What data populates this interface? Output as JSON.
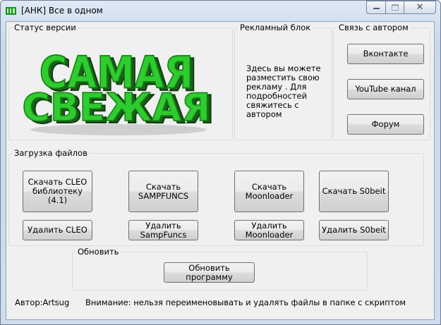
{
  "window": {
    "title": "[АНК] Все в одном",
    "minimize_icon": "minimize-icon",
    "maximize_icon": "maximize-icon",
    "close_icon": "close-icon",
    "close_glyph": "✕"
  },
  "version_group": {
    "label": "Статус версии",
    "logo_line1": "САМАЯ",
    "logo_line2": "СВЕЖАЯ",
    "logo_color": "#2ecc2e"
  },
  "ad_group": {
    "label": "Рекламный блок",
    "text": "Здесь вы можете разместить свою рекламу . Для подробностей свяжитесь с автором"
  },
  "contact_group": {
    "label": "Связь с автором",
    "buttons": [
      "Вконтакте",
      "YouTube канал",
      "Форум"
    ]
  },
  "downloads_group": {
    "label": "Загрузка файлов",
    "download_buttons": [
      "Скачать CLEO библиотеку (4.1)",
      "Скачать SAMPFUNCS",
      "Скачать Moonloader",
      "Скачать S0beit"
    ],
    "delete_buttons": [
      "Удалить CLEO",
      "Удалить SampFuncs",
      "Удалить Moonloader",
      "Удалить S0beit"
    ]
  },
  "update_group": {
    "label": "Обновить",
    "button": "Обновить программу"
  },
  "footer": {
    "author": "Автор:Artsug",
    "warning": "Внимание: нельзя переименовывать и удалять файлы в папке с скриптом"
  }
}
